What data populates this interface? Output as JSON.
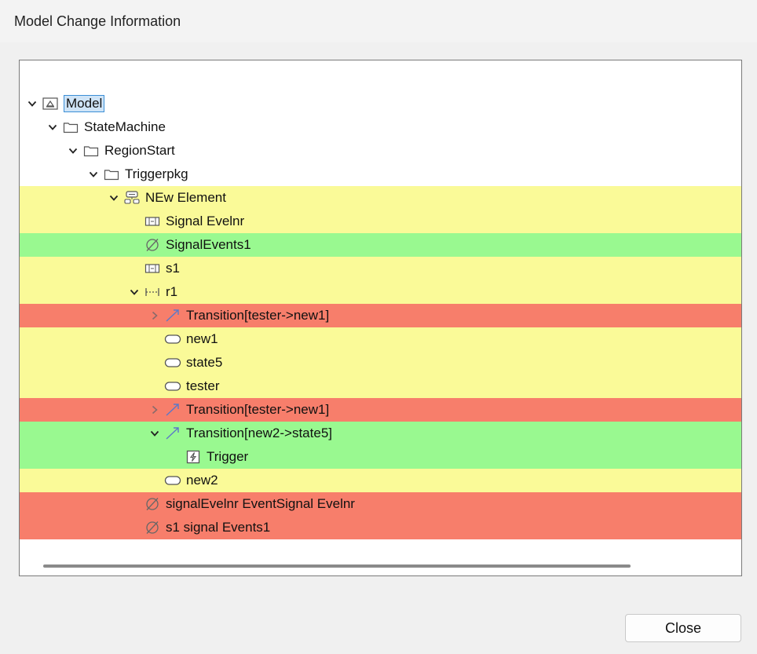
{
  "window": {
    "title": "Model Change Information"
  },
  "tree": {
    "rows": [
      {
        "label": "Model",
        "depth": 0,
        "toggle": "expanded",
        "icon": "model-icon",
        "status": "none",
        "selected": true
      },
      {
        "label": "StateMachine",
        "depth": 1,
        "toggle": "expanded",
        "icon": "folder-icon",
        "status": "none"
      },
      {
        "label": "RegionStart",
        "depth": 2,
        "toggle": "expanded",
        "icon": "folder-icon",
        "status": "none"
      },
      {
        "label": "Triggerpkg",
        "depth": 3,
        "toggle": "expanded",
        "icon": "folder-icon",
        "status": "none"
      },
      {
        "label": "NEw Element",
        "depth": 4,
        "toggle": "expanded",
        "icon": "state-machine-icon",
        "status": "modified"
      },
      {
        "label": "Signal Evelnr",
        "depth": 5,
        "toggle": "none",
        "icon": "signal-icon",
        "status": "modified"
      },
      {
        "label": "SignalEvents1",
        "depth": 5,
        "toggle": "none",
        "icon": "signal-event-icon",
        "status": "added"
      },
      {
        "label": "s1",
        "depth": 5,
        "toggle": "none",
        "icon": "signal-icon",
        "status": "modified"
      },
      {
        "label": "r1",
        "depth": 5,
        "toggle": "expanded",
        "icon": "region-icon",
        "status": "modified"
      },
      {
        "label": "Transition[tester->new1]",
        "depth": 6,
        "toggle": "collapsed",
        "icon": "transition-icon",
        "status": "deleted"
      },
      {
        "label": "new1",
        "depth": 6,
        "toggle": "none",
        "icon": "state-icon",
        "status": "modified"
      },
      {
        "label": "state5",
        "depth": 6,
        "toggle": "none",
        "icon": "state-icon",
        "status": "modified"
      },
      {
        "label": "tester",
        "depth": 6,
        "toggle": "none",
        "icon": "state-icon",
        "status": "modified"
      },
      {
        "label": "Transition[tester->new1]",
        "depth": 6,
        "toggle": "collapsed",
        "icon": "transition-icon",
        "status": "deleted"
      },
      {
        "label": "Transition[new2->state5]",
        "depth": 6,
        "toggle": "expanded",
        "icon": "transition-icon",
        "status": "added"
      },
      {
        "label": "Trigger",
        "depth": 7,
        "toggle": "none",
        "icon": "trigger-icon",
        "status": "added"
      },
      {
        "label": "new2",
        "depth": 6,
        "toggle": "none",
        "icon": "state-icon",
        "status": "modified"
      },
      {
        "label": "signalEvelnr EventSignal Evelnr",
        "depth": 5,
        "toggle": "none",
        "icon": "signal-event-icon",
        "status": "deleted"
      },
      {
        "label": "s1 signal Events1",
        "depth": 5,
        "toggle": "none",
        "icon": "signal-event-icon",
        "status": "deleted"
      }
    ]
  },
  "colors": {
    "modified": "#fafa98",
    "added": "#99f990",
    "deleted": "#f77e6b",
    "selection_border": "#3c8fd6"
  },
  "footer": {
    "close_label": "Close"
  }
}
